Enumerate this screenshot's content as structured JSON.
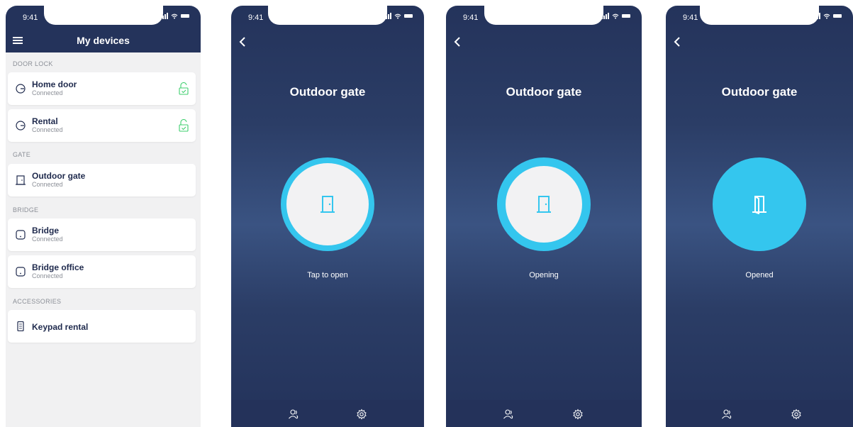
{
  "status_time": "9:41",
  "list_screen": {
    "title": "My devices",
    "sections": [
      {
        "label": "DOOR LOCK",
        "items": [
          {
            "name": "Home door",
            "status": "Connected"
          },
          {
            "name": "Rental",
            "status": "Connected"
          }
        ]
      },
      {
        "label": "GATE",
        "items": [
          {
            "name": "Outdoor gate",
            "status": "Connected"
          }
        ]
      },
      {
        "label": "BRIDGE",
        "items": [
          {
            "name": "Bridge",
            "status": "Connected"
          },
          {
            "name": "Bridge office",
            "status": "Connected"
          }
        ]
      },
      {
        "label": "ACCESSORIES",
        "items": [
          {
            "name": "Keypad rental",
            "status": ""
          }
        ]
      }
    ],
    "icons": {
      "door_lock": "lock-dial-icon",
      "gate": "gate-icon",
      "bridge": "bridge-icon",
      "keypad": "keypad-icon",
      "unlocked": "unlocked-padlock-icon"
    }
  },
  "gate_screens": [
    {
      "title": "Outdoor gate",
      "status": "Tap to open"
    },
    {
      "title": "Outdoor gate",
      "status": "Opening"
    },
    {
      "title": "Outdoor gate",
      "status": "Opened"
    }
  ],
  "colors": {
    "navy": "#24335b",
    "accent_blue": "#34c6ee",
    "unlocked_green": "#3ecf6e",
    "list_bg": "#f1f1f2"
  }
}
